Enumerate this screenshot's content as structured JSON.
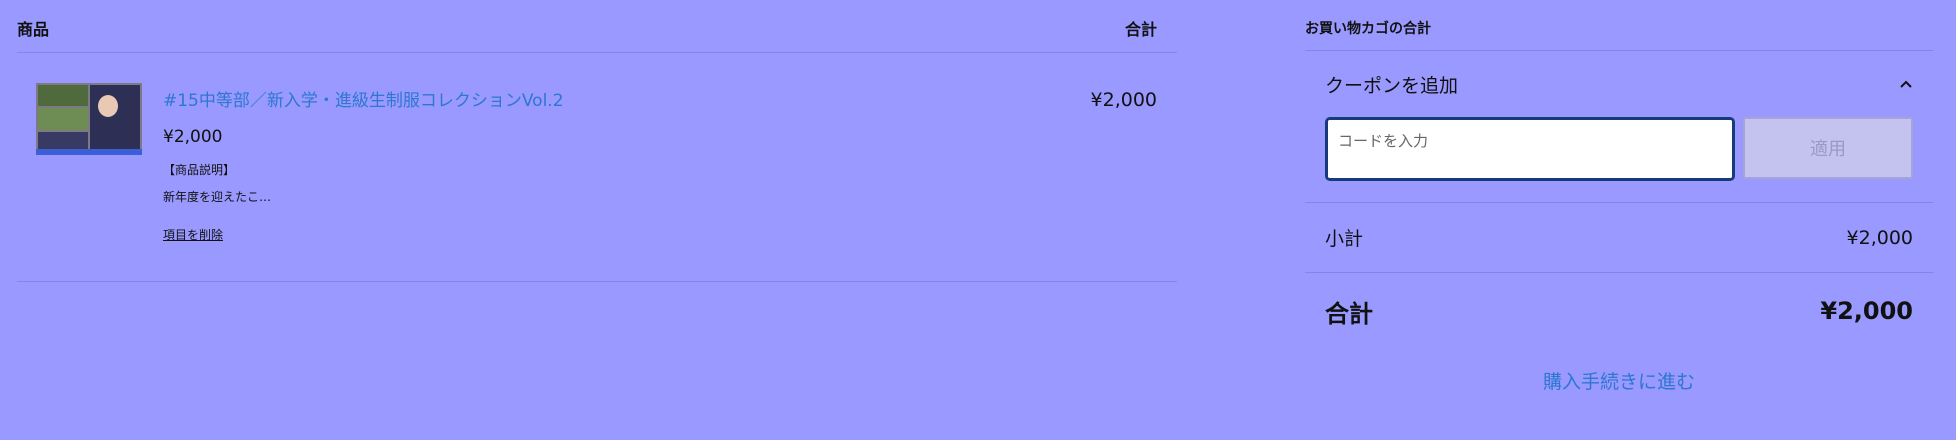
{
  "cart": {
    "header_product": "商品",
    "header_total": "合計",
    "items": [
      {
        "title": "#15中等部／新入学・進級生制服コレクションVol.2",
        "price": "¥2,000",
        "desc_heading": "【商品説明】",
        "desc": "新年度を迎えたこ…",
        "remove_label": "項目を削除",
        "line_total": "¥2,000"
      }
    ]
  },
  "totals": {
    "title": "お買い物カゴの合計",
    "coupon_toggle_label": "クーポンを追加",
    "coupon_placeholder": "コードを入力",
    "apply_label": "適用",
    "subtotal_label": "小計",
    "subtotal_value": "¥2,000",
    "total_label": "合計",
    "total_value": "¥2,000",
    "checkout_label": "購入手続きに進む"
  },
  "icons": {
    "coupon_toggle": "chevron-up-icon"
  },
  "colors": {
    "background": "#9999ff",
    "link": "#2e77d0",
    "input_border": "#173a7a"
  }
}
